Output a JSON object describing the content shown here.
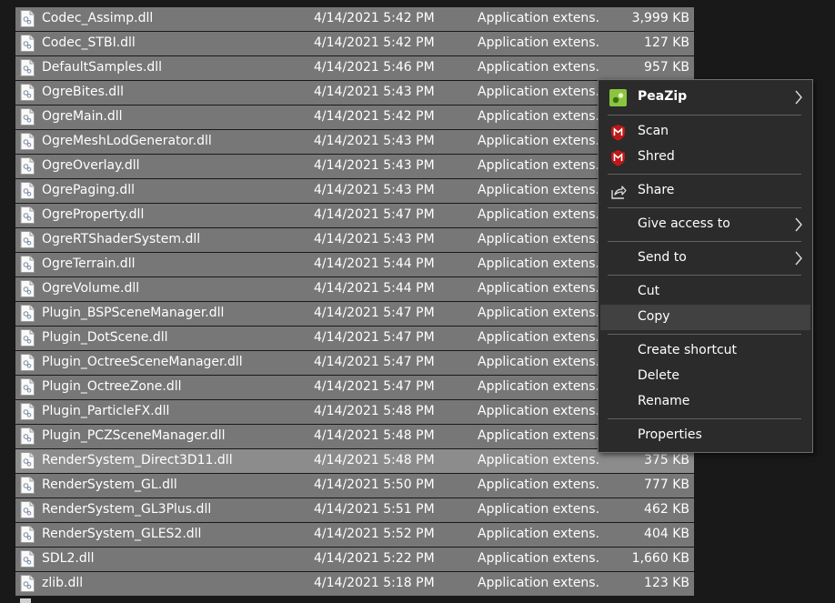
{
  "files": [
    {
      "name": "Codec_Assimp.dll",
      "date": "4/14/2021 5:42 PM",
      "type": "Application extens...",
      "size": "3,999 KB"
    },
    {
      "name": "Codec_STBI.dll",
      "date": "4/14/2021 5:42 PM",
      "type": "Application extens...",
      "size": "127 KB"
    },
    {
      "name": "DefaultSamples.dll",
      "date": "4/14/2021 5:46 PM",
      "type": "Application extens...",
      "size": "957 KB"
    },
    {
      "name": "OgreBites.dll",
      "date": "4/14/2021 5:43 PM",
      "type": "Application extens...",
      "size": ""
    },
    {
      "name": "OgreMain.dll",
      "date": "4/14/2021 5:42 PM",
      "type": "Application extens...",
      "size": ""
    },
    {
      "name": "OgreMeshLodGenerator.dll",
      "date": "4/14/2021 5:43 PM",
      "type": "Application extens...",
      "size": ""
    },
    {
      "name": "OgreOverlay.dll",
      "date": "4/14/2021 5:43 PM",
      "type": "Application extens...",
      "size": ""
    },
    {
      "name": "OgrePaging.dll",
      "date": "4/14/2021 5:43 PM",
      "type": "Application extens...",
      "size": ""
    },
    {
      "name": "OgreProperty.dll",
      "date": "4/14/2021 5:47 PM",
      "type": "Application extens...",
      "size": ""
    },
    {
      "name": "OgreRTShaderSystem.dll",
      "date": "4/14/2021 5:43 PM",
      "type": "Application extens...",
      "size": ""
    },
    {
      "name": "OgreTerrain.dll",
      "date": "4/14/2021 5:44 PM",
      "type": "Application extens...",
      "size": ""
    },
    {
      "name": "OgreVolume.dll",
      "date": "4/14/2021 5:44 PM",
      "type": "Application extens...",
      "size": ""
    },
    {
      "name": "Plugin_BSPSceneManager.dll",
      "date": "4/14/2021 5:47 PM",
      "type": "Application extens...",
      "size": ""
    },
    {
      "name": "Plugin_DotScene.dll",
      "date": "4/14/2021 5:47 PM",
      "type": "Application extens...",
      "size": ""
    },
    {
      "name": "Plugin_OctreeSceneManager.dll",
      "date": "4/14/2021 5:47 PM",
      "type": "Application extens...",
      "size": ""
    },
    {
      "name": "Plugin_OctreeZone.dll",
      "date": "4/14/2021 5:47 PM",
      "type": "Application extens...",
      "size": ""
    },
    {
      "name": "Plugin_ParticleFX.dll",
      "date": "4/14/2021 5:48 PM",
      "type": "Application extens...",
      "size": ""
    },
    {
      "name": "Plugin_PCZSceneManager.dll",
      "date": "4/14/2021 5:48 PM",
      "type": "Application extens...",
      "size": ""
    },
    {
      "name": "RenderSystem_Direct3D11.dll",
      "date": "4/14/2021 5:48 PM",
      "type": "Application extens...",
      "size": "375 KB"
    },
    {
      "name": "RenderSystem_GL.dll",
      "date": "4/14/2021 5:50 PM",
      "type": "Application extens...",
      "size": "777 KB"
    },
    {
      "name": "RenderSystem_GL3Plus.dll",
      "date": "4/14/2021 5:51 PM",
      "type": "Application extens...",
      "size": "462 KB"
    },
    {
      "name": "RenderSystem_GLES2.dll",
      "date": "4/14/2021 5:52 PM",
      "type": "Application extens...",
      "size": "404 KB"
    },
    {
      "name": "SDL2.dll",
      "date": "4/14/2021 5:22 PM",
      "type": "Application extens...",
      "size": "1,660 KB"
    },
    {
      "name": "zlib.dll",
      "date": "4/14/2021 5:18 PM",
      "type": "Application extens...",
      "size": "123 KB"
    }
  ],
  "focused_index": 18,
  "context_menu": {
    "items": [
      {
        "label": "PeaZip",
        "icon": "peazip-icon",
        "submenu": true,
        "bold": true
      },
      {
        "label": "Scan",
        "icon": "mcafee-icon",
        "submenu": false
      },
      {
        "label": "Shred",
        "icon": "mcafee-icon",
        "submenu": false
      },
      {
        "label": "Share",
        "icon": "share-icon",
        "submenu": false
      },
      {
        "label": "Give access to",
        "icon": "",
        "submenu": true
      },
      {
        "label": "Send to",
        "icon": "",
        "submenu": true
      },
      {
        "label": "Cut",
        "icon": "",
        "submenu": false
      },
      {
        "label": "Copy",
        "icon": "",
        "submenu": false,
        "hover": true
      },
      {
        "label": "Create shortcut",
        "icon": "",
        "submenu": false
      },
      {
        "label": "Delete",
        "icon": "",
        "submenu": false
      },
      {
        "label": "Rename",
        "icon": "",
        "submenu": false
      },
      {
        "label": "Properties",
        "icon": "",
        "submenu": false
      }
    ]
  },
  "colors": {
    "row_bg": "#777777",
    "row_focused_bg": "#8c8c8c",
    "menu_bg": "#2b2b2b",
    "menu_hover_bg": "#414141",
    "mcafee_red": "#c01818",
    "peazip_green": "#8bc53f"
  }
}
